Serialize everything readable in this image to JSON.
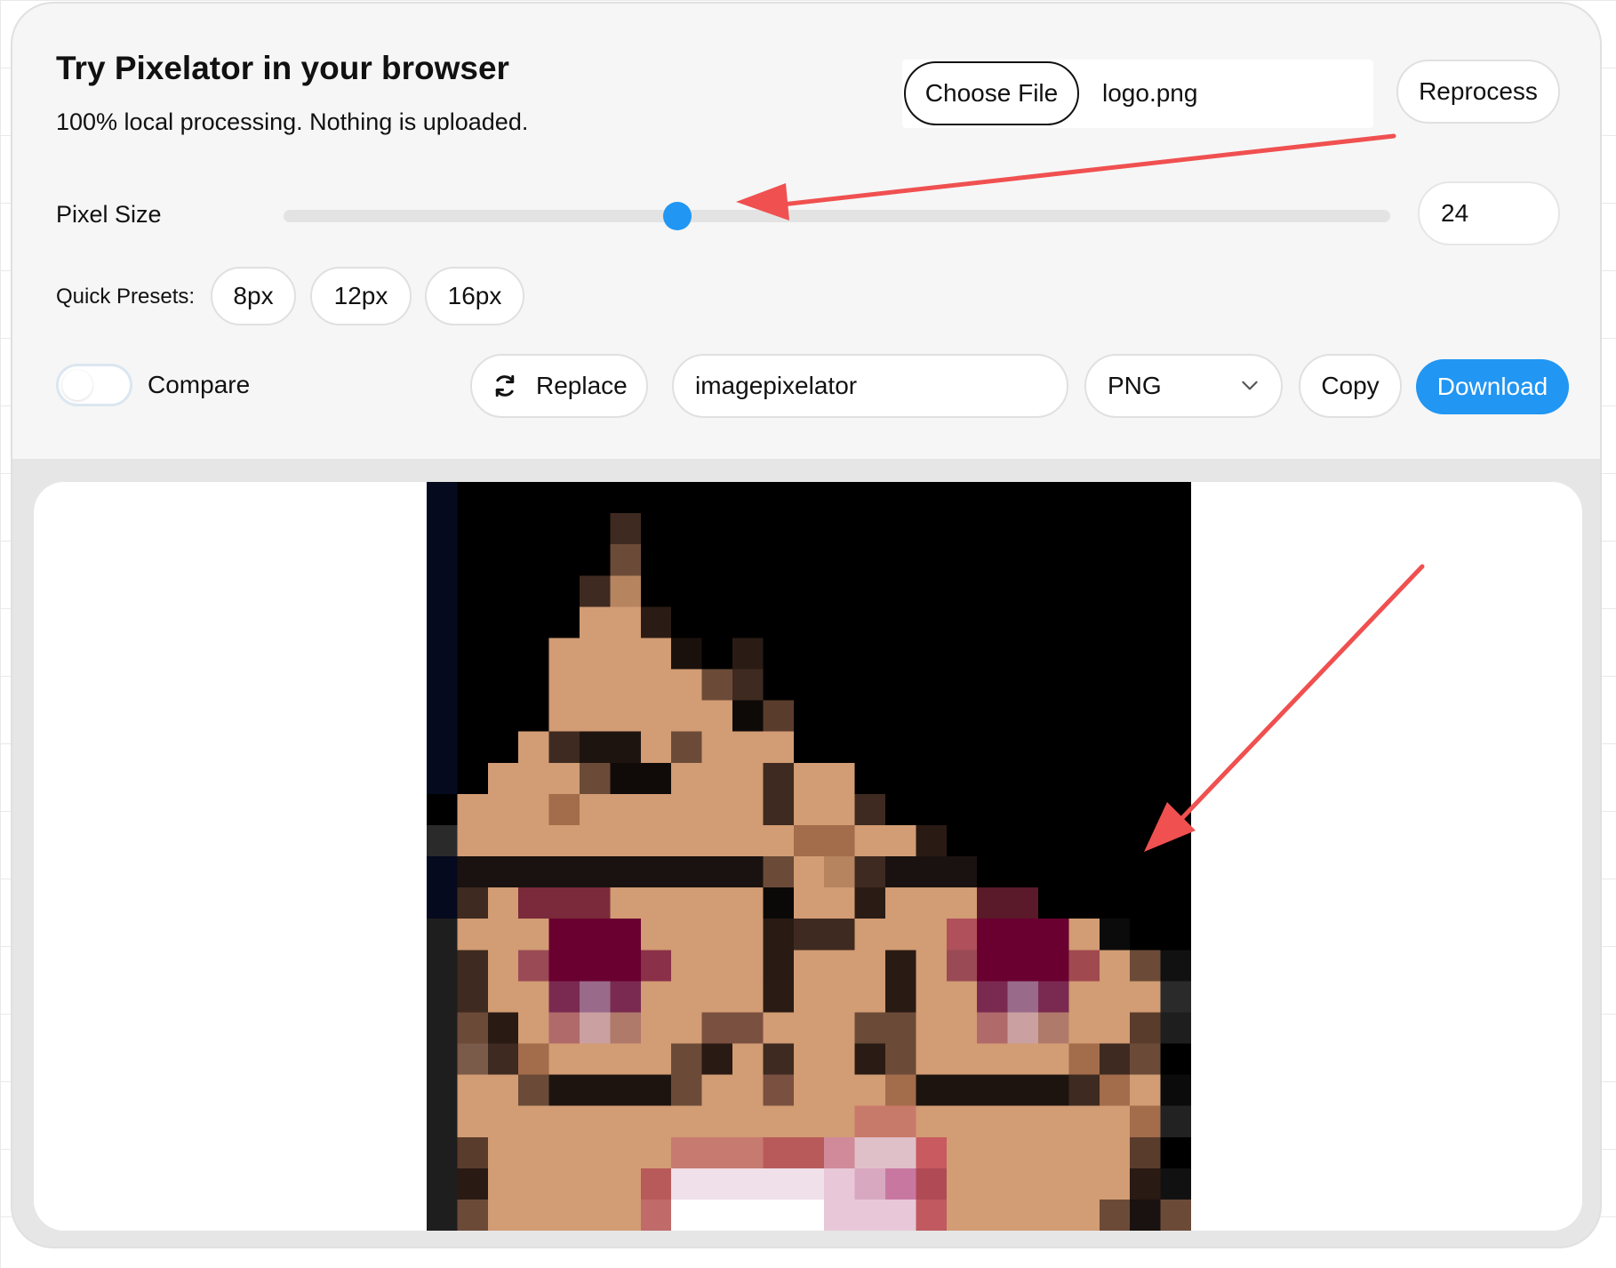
{
  "header": {
    "title": "Try Pixelator in your browser",
    "subtitle": "100% local processing. Nothing is uploaded."
  },
  "file": {
    "choose_label": "Choose File",
    "file_name": "logo.png",
    "reprocess_label": "Reprocess"
  },
  "pixel_size": {
    "label": "Pixel Size",
    "value": "24",
    "slider_fraction": 0.356
  },
  "presets": {
    "label": "Quick Presets:",
    "items": [
      "8px",
      "12px",
      "16px"
    ]
  },
  "toolbar": {
    "compare_label": "Compare",
    "compare_on": false,
    "replace_label": "Replace",
    "filename_value": "imagepixelator",
    "format_value": "PNG",
    "copy_label": "Copy",
    "download_label": "Download"
  },
  "icons": {
    "replace": "refresh-icon",
    "format_dropdown": "chevron-down-icon"
  },
  "colors": {
    "accent": "#2196f3",
    "annotation_arrow": "#f05050"
  }
}
